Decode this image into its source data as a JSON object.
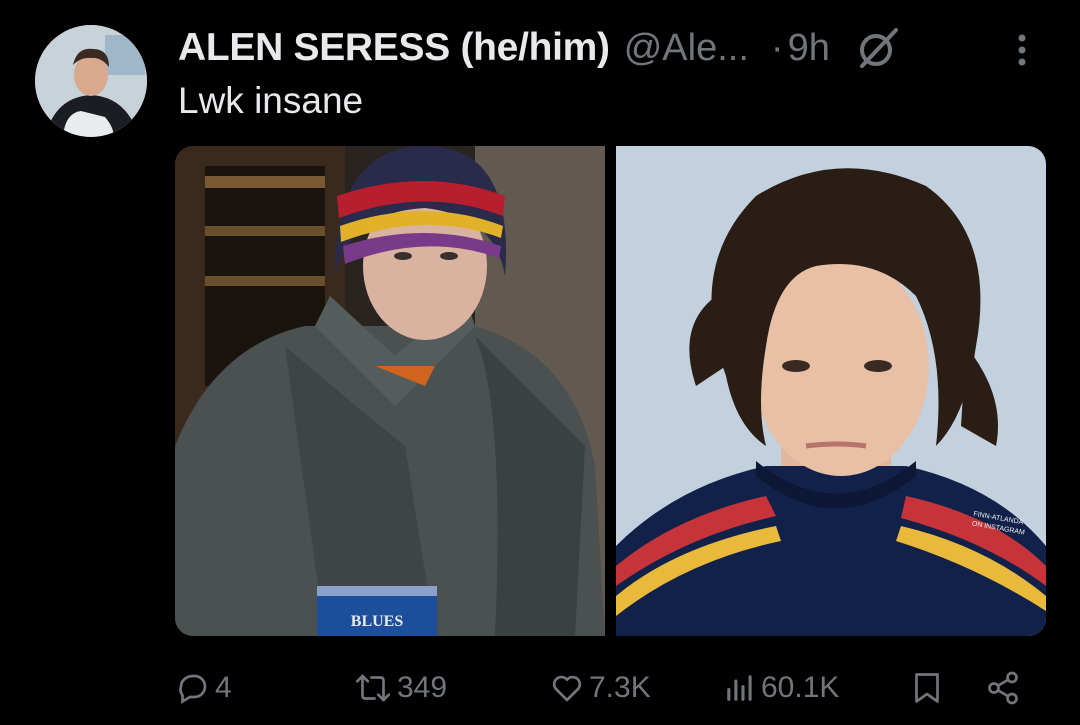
{
  "author": {
    "display_name": "ALEN SERESS (he/him)",
    "handle": "@Ale...",
    "separator": "·",
    "time": "9h"
  },
  "tweet": {
    "text": "Lwk insane"
  },
  "media": {
    "left_photo": {
      "bag_label": "BLUES"
    },
    "right_photo": {
      "watermark_line1": "FINN-ATLANDA",
      "watermark_line2": "ON INSTAGRAM"
    }
  },
  "actions": {
    "replies": "4",
    "reposts": "349",
    "likes": "7.3K",
    "views": "60.1K"
  },
  "icons": [
    "grok-icon",
    "more-icon",
    "reply-icon",
    "repost-icon",
    "like-icon",
    "views-icon",
    "bookmark-icon",
    "share-icon"
  ],
  "colors": {
    "background": "#000000",
    "text": "#e7e9ea",
    "secondary": "#71767b"
  }
}
